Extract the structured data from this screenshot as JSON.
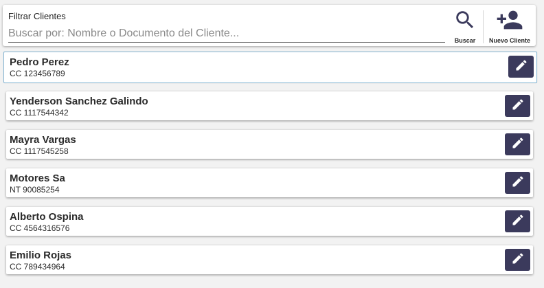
{
  "filter": {
    "label": "Filtrar Clientes",
    "placeholder": "Buscar por: Nombre o Documento del Cliente...",
    "value": ""
  },
  "toolbar": {
    "search_label": "Buscar",
    "search_icon": "search-icon",
    "new_client_label": "Nuevo Cliente",
    "new_client_icon": "person-add-icon"
  },
  "clients": [
    {
      "name": "Pedro Perez",
      "document": "CC 123456789",
      "selected": true
    },
    {
      "name": "Yenderson Sanchez Galindo",
      "document": "CC 1117544342",
      "selected": false
    },
    {
      "name": "Mayra Vargas",
      "document": "CC 1117545258",
      "selected": false
    },
    {
      "name": "Motores Sa",
      "document": "NT 90085254",
      "selected": false
    },
    {
      "name": "Alberto Ospina",
      "document": "CC 4564316576",
      "selected": false
    },
    {
      "name": "Emilio Rojas",
      "document": "CC 789434964",
      "selected": false
    }
  ],
  "colors": {
    "edit_button": "#3b3a5c",
    "selected_border": "#87b8d6",
    "background": "#f2f2f2"
  }
}
